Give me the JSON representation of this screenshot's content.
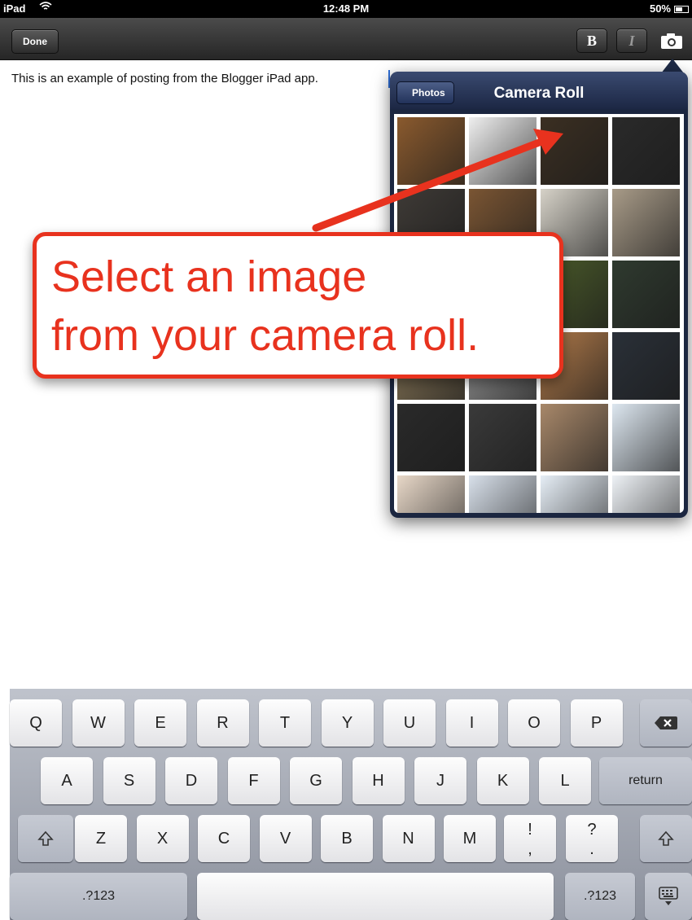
{
  "status_bar": {
    "carrier": "iPad",
    "time": "12:48 PM",
    "battery": "50%"
  },
  "toolbar": {
    "done_label": "Done",
    "bold_label": "B",
    "italic_label": "I",
    "camera_icon": "camera-icon"
  },
  "editor": {
    "text": "This is an example of posting from the Blogger iPad app."
  },
  "popover": {
    "back_label": "Photos",
    "title": "Camera Roll",
    "thumbnail_count": 24,
    "thumb_colors": [
      "#8a5a2e",
      "#efefef",
      "#3b2f22",
      "#2a2a2a",
      "#3e3a36",
      "#7a5533",
      "#d6d2c8",
      "#a89b88",
      "#6a5a4a",
      "#556b2f",
      "#4a5a2a",
      "#2f3a2f",
      "#8c7a5a",
      "#9a9a9a",
      "#b07a4a",
      "#2a3038",
      "#2a2a2a",
      "#3a3a3a",
      "#a8886a",
      "#dde7f0",
      "#e8d8c8",
      "#d8e0ea",
      "#e6eef6",
      "#eef2f6"
    ]
  },
  "callout": {
    "line1": "Select an image",
    "line2": "from your camera roll."
  },
  "keyboard": {
    "row1": [
      "Q",
      "W",
      "E",
      "R",
      "T",
      "Y",
      "U",
      "I",
      "O",
      "P"
    ],
    "row2": [
      "A",
      "S",
      "D",
      "F",
      "G",
      "H",
      "J",
      "K",
      "L"
    ],
    "row3": [
      "Z",
      "X",
      "C",
      "V",
      "B",
      "N",
      "M"
    ],
    "return_label": "return",
    "numbers_label": ".?123",
    "punct1": [
      "!",
      ","
    ],
    "punct2": [
      "?",
      "."
    ]
  }
}
